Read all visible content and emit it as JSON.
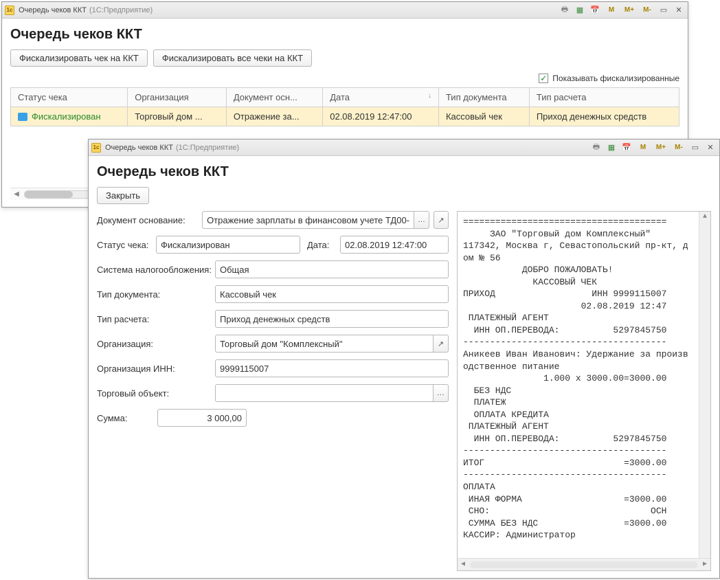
{
  "app": {
    "title": "Очередь чеков ККТ",
    "suffix": "(1С:Предприятие)"
  },
  "page_title": "Очередь чеков ККТ",
  "toolbar": {
    "fiscalize_one": "Фискализировать чек на ККТ",
    "fiscalize_all": "Фискализировать все чеки на ККТ",
    "show_fiscalized_label": "Показывать фискализированные",
    "show_fiscalized_checked": true
  },
  "columns": {
    "status": "Статус чека",
    "org": "Организация",
    "doc": "Документ осн...",
    "date": "Дата",
    "doctype": "Тип документа",
    "calctype": "Тип расчета"
  },
  "rows": [
    {
      "status": "Фискализирован",
      "org": "Торговый дом ...",
      "doc": "Отражение за...",
      "date": "02.08.2019 12:47:00",
      "doctype": "Кассовый чек",
      "calctype": "Приход денежных средств"
    }
  ],
  "detail": {
    "close_btn": "Закрыть",
    "labels": {
      "doc_base": "Документ основание:",
      "status": "Статус чека:",
      "date": "Дата:",
      "tax": "Система налогообложения:",
      "doctype": "Тип документа:",
      "calctype": "Тип расчета:",
      "org": "Организация:",
      "org_inn": "Организация ИНН:",
      "trade_obj": "Торговый объект:",
      "sum": "Сумма:"
    },
    "values": {
      "doc_base": "Отражение зарплаты в финансовом учете ТД00-",
      "status": "Фискализирован",
      "date": "02.08.2019 12:47:00",
      "tax": "Общая",
      "doctype": "Кассовый чек",
      "calctype": "Приход денежных средств",
      "org": "Торговый дом \"Комплексный\"",
      "org_inn": "9999115007",
      "trade_obj": "",
      "sum": "3 000,00"
    }
  },
  "receipt_text": "======================================\n     ЗАО \"Торговый дом Комплексный\"\n117342, Москва г, Севастопольский пр-кт, д\nом № 56\n           ДОБРО ПОЖАЛОВАТЬ!\n             КАССОВЫЙ ЧЕК\nПРИХОД                  ИНН 9999115007\n                      02.08.2019 12:47\n ПЛАТЕЖНЫЙ АГЕНТ\n  ИНН ОП.ПЕРЕВОДА:          5297845750\n--------------------------------------\nАникеев Иван Иванович: Удержание за произв\nодственное питание\n               1.000 x 3000.00=3000.00\n  БЕЗ НДС\n  ПЛАТЕЖ\n  ОПЛАТА КРЕДИТА\n ПЛАТЕЖНЫЙ АГЕНТ\n  ИНН ОП.ПЕРЕВОДА:          5297845750\n--------------------------------------\nИТОГ                          =3000.00\n--------------------------------------\nОПЛАТА\n ИНАЯ ФОРМА                   =3000.00\n СНО:                              ОСН\n СУММА БЕЗ НДС                =3000.00\nКАССИР: Администратор"
}
